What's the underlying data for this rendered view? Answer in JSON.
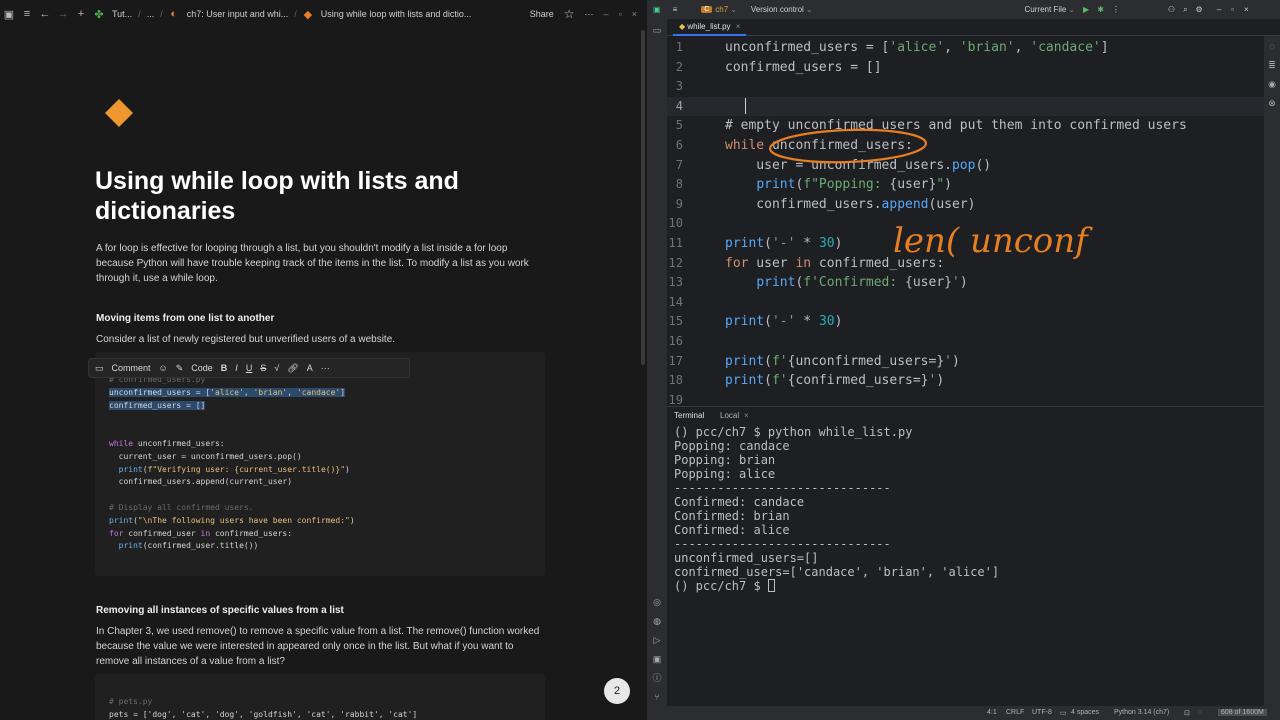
{
  "notion": {
    "breadcrumb": [
      "Tut...",
      "...",
      "ch7: User input and whi...",
      "Using while loop with lists and dictio..."
    ],
    "share_label": "Share",
    "title": "Using while loop with lists and dictionaries",
    "intro": "A for loop is effective for looping through a list, but you shouldn't modify a list inside a for loop because Python will have trouble keeping track of the items in the list. To modify a list as you work through it, use a while loop.",
    "section1_heading": "Moving items from one list to another",
    "section1_text": "Consider a list of newly registered but unverified users of a website.",
    "toolbar": {
      "comment": "Comment",
      "code": "Code",
      "bold": "B",
      "italic": "I",
      "underline": "U",
      "strike": "S",
      "text_color": "A",
      "more": "···"
    },
    "section2_heading": "Removing all instances of specific values from a list",
    "section2_text": "In Chapter 3, we used remove() to remove a specific value from a list. The remove() function worked because the value we were interested in appeared only once in the list. But what if you want to remove all instances of a value from a list?",
    "code2": [
      "# pets.py",
      "pets = ['dog', 'cat', 'dog', 'goldfish', 'cat', 'rabbit', 'cat']"
    ],
    "avatar_label": "2"
  },
  "pycharm": {
    "project": "ch7",
    "version_control": "Version control",
    "run_config": "Current File",
    "file_tab": "while_list.py",
    "terminal_tab": "Terminal",
    "local_tab": "Local",
    "terminal_lines": [
      "() pcc/ch7 $ python while_list.py",
      "Popping: candace",
      "Popping: brian",
      "Popping: alice",
      "------------------------------",
      "Confirmed: candace",
      "Confirmed: brian",
      "Confirmed: alice",
      "------------------------------",
      "unconfirmed_users=[]",
      "confirmed_users=['candace', 'brian', 'alice']",
      "() pcc/ch7 $ "
    ],
    "handwriting": "len( unconf",
    "status": {
      "position": "4:1",
      "line_sep": "CRLF",
      "encoding": "UTF-8",
      "indent": "4 spaces",
      "interpreter": "Python 3.14 (ch7)",
      "memory": "608 of 1600M"
    },
    "accent_orange": "#e67e22"
  }
}
